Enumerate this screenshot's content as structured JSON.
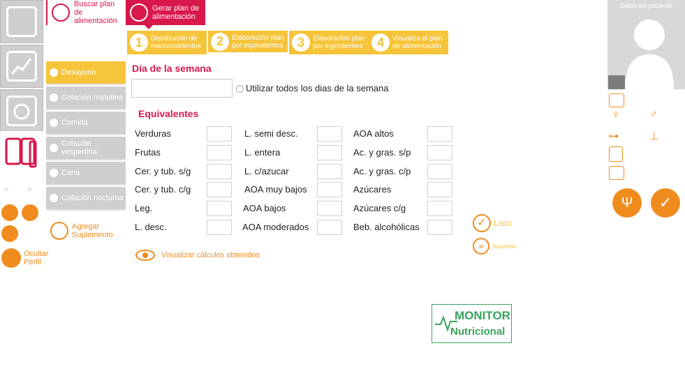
{
  "top_tabs": {
    "search_plan": "Buscar plan de alimentación",
    "generate_plan": "Gerar plan de alimentación"
  },
  "steps": [
    {
      "num": "1",
      "label": "Distribución de macronutrientes"
    },
    {
      "num": "2",
      "label": "Elaboración plan por equivalentes"
    },
    {
      "num": "3",
      "label": "Elaboración plan por ingredientes"
    },
    {
      "num": "4",
      "label": "Visualiza el plan de alimentación"
    }
  ],
  "meals": [
    {
      "label": "Desayuno",
      "active": true
    },
    {
      "label": "Colación matutina",
      "active": false
    },
    {
      "label": "Comida",
      "active": false
    },
    {
      "label": "Colación vespertina",
      "active": false
    },
    {
      "label": "Cena",
      "active": false
    },
    {
      "label": "Colación nocturna",
      "active": false
    }
  ],
  "sidebar_actions": {
    "add_supplement": "Agregar Suplemento",
    "hide_profile": "Ocultar Perfil"
  },
  "main": {
    "day_title": "Día de la semana",
    "day_value": "",
    "use_all_days_label": "Utilizar todos los dias de la semana",
    "equivalents_title": "Equivalentes",
    "equivalents": [
      [
        "Verduras",
        "L. semi desc.",
        "AOA altos"
      ],
      [
        "Frutas",
        "L. entera",
        "Ac. y gras. s/p"
      ],
      [
        "Cer. y tub. s/g",
        "L. c/azucar",
        "Ac. y gras. c/p"
      ],
      [
        "Cer. y tub. c/g",
        "AOA muy bajos",
        "Azúcares"
      ],
      [
        "Leg.",
        "AOA bajos",
        "Azúcares c/g"
      ],
      [
        "L. desc.",
        "AOA moderados",
        "Beb. alcohólicas"
      ]
    ],
    "visualize_label": "Visualizar cálculos obtenidos",
    "done_label": "Listo",
    "next_label": "Siguiente"
  },
  "patient": {
    "title": "Datos del paciente"
  },
  "logo": {
    "line1": "MONITOR",
    "line2": "Nutricional"
  },
  "colors": {
    "accent_red": "#d8174a",
    "yellow": "#f6c43a",
    "orange": "#f08c1e",
    "green": "#3aa15d"
  }
}
